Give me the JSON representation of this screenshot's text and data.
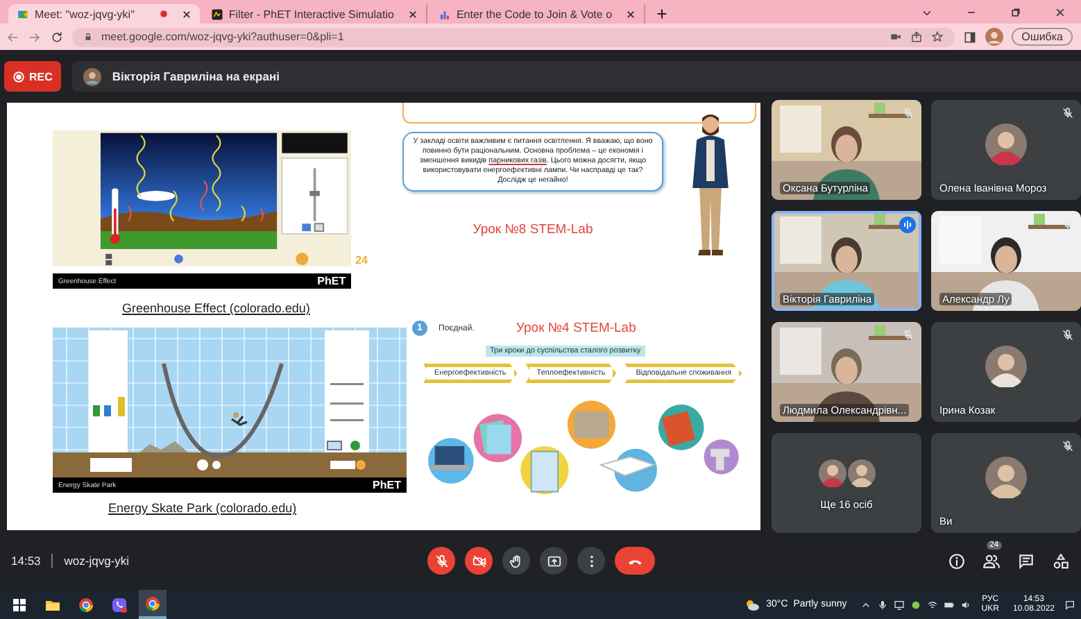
{
  "browser": {
    "tabs": [
      {
        "title": "Meet: \"woz-jqvg-yki\"",
        "selected": true,
        "recording": true
      },
      {
        "title": "Filter - PhET Interactive Simulatio",
        "selected": false,
        "recording": false
      },
      {
        "title": "Enter the Code to Join & Vote o",
        "selected": false,
        "recording": false
      }
    ],
    "url": "meet.google.com/woz-jqvg-yki?authuser=0&pli=1",
    "profile_button": "Ошибка"
  },
  "meet": {
    "rec_label": "REC",
    "presenter": "Вікторія Гаврилiна на екрані",
    "slide": {
      "sims": [
        {
          "title": "Greenhouse Effect",
          "brand": "PhET",
          "caption": "Greenhouse Effect (colorado.edu)",
          "kind": "greenhouse"
        },
        {
          "title": "Energy Skate Park",
          "brand": "PhET",
          "caption": "Energy Skate Park (colorado.edu)",
          "kind": "skate"
        }
      ],
      "page_number": "24",
      "bubble_text": "У закладі освіти важливим є питання освітлення. Я вважаю, що воно повинно бути раціональним. Основна проблема – це економія і зменшення викидів **парникових газів**. Цього можна досягти, якщо використовувати енергоефективні лампи. Чи насправді це так? Дослідж це негайно!",
      "lesson_top": "Урок №8 STEM-Lab",
      "step": "1",
      "instruction": "Поєднай.",
      "lesson_bottom": "Урок №4 STEM-Lab",
      "subtitle": "Три кроки до суспільства сталого розвитку",
      "steps": [
        "Енергоефективність",
        "Теплоефективність",
        "Відповідальне споживання"
      ]
    },
    "tiles": [
      {
        "name": "Оксана Бутурліна",
        "kind": "video",
        "muted": true,
        "speaking": false
      },
      {
        "name": "Олена Іванівна Мороз",
        "kind": "avatar",
        "muted": true,
        "speaking": false
      },
      {
        "name": "Вікторія Гаврилiна",
        "kind": "video",
        "muted": false,
        "speaking": true
      },
      {
        "name": "Александр Лу",
        "kind": "video",
        "muted": true,
        "speaking": false
      },
      {
        "name": "Людмила Олександрівн...",
        "kind": "video",
        "muted": true,
        "speaking": false
      },
      {
        "name": "Ірина Козак",
        "kind": "avatar",
        "muted": true,
        "speaking": false
      },
      {
        "name": "Ще 16 осіб",
        "kind": "group",
        "muted": false,
        "speaking": false
      },
      {
        "name": "Ви",
        "kind": "avatar",
        "muted": true,
        "speaking": false
      }
    ],
    "time": "14:53",
    "code": "woz-jqvg-yki",
    "controls": [
      {
        "kind": "mic",
        "on": false
      },
      {
        "kind": "camera",
        "on": false
      },
      {
        "kind": "hand"
      },
      {
        "kind": "present"
      },
      {
        "kind": "more"
      },
      {
        "kind": "hangup"
      }
    ],
    "side_controls": [
      {
        "kind": "info"
      },
      {
        "kind": "people",
        "badge": "24"
      },
      {
        "kind": "chat"
      },
      {
        "kind": "activities"
      }
    ]
  },
  "taskbar": {
    "apps": [
      {
        "kind": "windows",
        "selected": false
      },
      {
        "kind": "folder",
        "selected": false
      },
      {
        "kind": "chrome",
        "selected": false
      },
      {
        "kind": "viber",
        "selected": false
      },
      {
        "kind": "chrome",
        "selected": true
      }
    ],
    "temperature": "30°C",
    "forecast": "Partly sunny",
    "lang": [
      "РУС",
      "UKR"
    ],
    "clock": "14:53",
    "date": "10.08.2022"
  }
}
